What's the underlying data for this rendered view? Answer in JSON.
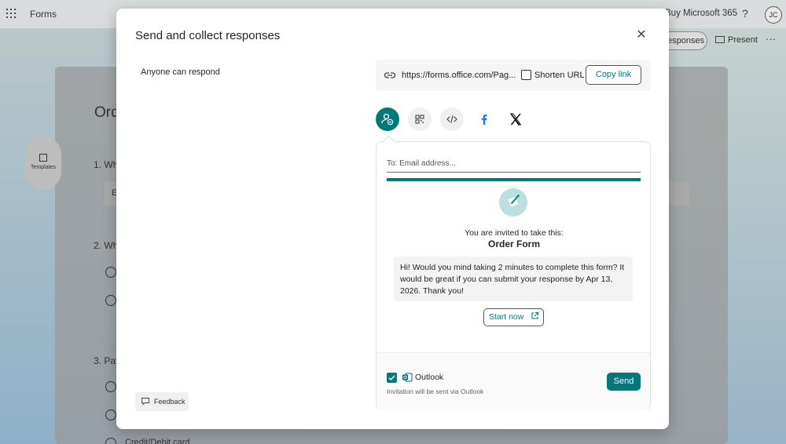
{
  "app": {
    "name": "Forms",
    "buy_label": "Buy Microsoft 365",
    "help_label": "?",
    "avatar_initials": "JC",
    "responses_label": "esponses",
    "present_label": "Present",
    "more_label": "···",
    "templates_label": "Templates"
  },
  "background_form": {
    "title": "Ord",
    "q1": "1. Wh",
    "q1_input": "E",
    "q2": "2. Wh",
    "q3": "3. Pay",
    "last_option": "Credit/Debit card"
  },
  "modal": {
    "title": "Send and collect responses",
    "close_label": "✕",
    "audience_label": "Anyone can respond",
    "link": {
      "url": "https://forms.office.com/Pag...",
      "shorten_label": "Shorten URL",
      "shorten_checked": false,
      "copy_label": "Copy link"
    },
    "share_options": [
      {
        "name": "email-invite",
        "icon": "person-mail-icon",
        "selected": true
      },
      {
        "name": "qr-code",
        "icon": "qr-code-icon",
        "selected": false
      },
      {
        "name": "embed",
        "icon": "code-icon",
        "selected": false
      },
      {
        "name": "facebook",
        "icon": "facebook-icon",
        "selected": false
      },
      {
        "name": "x",
        "icon": "x-icon",
        "selected": false
      }
    ],
    "email": {
      "to_placeholder": "To: Email address...",
      "invited_text": "You are invited to take this:",
      "form_name": "Order Form",
      "message": "Hi! Would you mind taking 2 minutes to complete this form? It would be great if you can submit your response by Apr 13, 2026. Thank you!",
      "start_label": "Start now",
      "outlook_label": "Outlook",
      "outlook_checked": true,
      "outlook_note": "Invitation will be sent via Outlook",
      "send_label": "Send"
    },
    "feedback_label": "Feedback"
  },
  "colors": {
    "accent": "#03787c",
    "accent_light": "#b9e0df"
  }
}
